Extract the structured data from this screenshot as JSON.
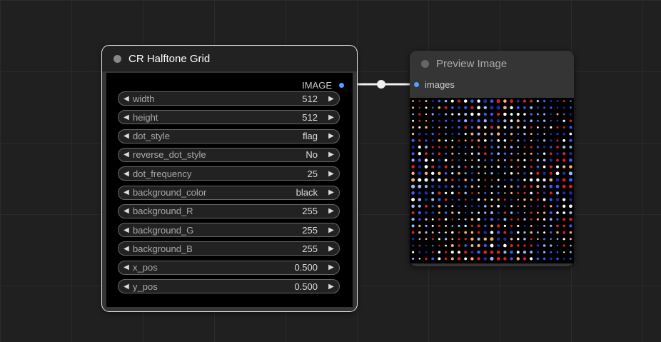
{
  "nodes": {
    "halftone": {
      "title": "CR Halftone Grid",
      "output_label": "IMAGE",
      "widgets": [
        {
          "label": "width",
          "value": "512"
        },
        {
          "label": "height",
          "value": "512"
        },
        {
          "label": "dot_style",
          "value": "flag"
        },
        {
          "label": "reverse_dot_style",
          "value": "No"
        },
        {
          "label": "dot_frequency",
          "value": "25"
        },
        {
          "label": "background_color",
          "value": "black"
        },
        {
          "label": "background_R",
          "value": "255"
        },
        {
          "label": "background_G",
          "value": "255"
        },
        {
          "label": "background_B",
          "value": "255"
        },
        {
          "label": "x_pos",
          "value": "0.500"
        },
        {
          "label": "y_pos",
          "value": "0.500"
        }
      ]
    },
    "preview": {
      "title": "Preview Image",
      "input_label": "images"
    }
  },
  "glyphs": {
    "arrow_left": "◀",
    "arrow_right": "▶"
  },
  "colors": {
    "canvas": "#202020",
    "node": "#353535",
    "slot": "#4da3ff",
    "dot_palette": [
      "#ffffff",
      "#e02020",
      "#3a5cff",
      "#ffb070",
      "#9fb8ff",
      "#1a2fb0"
    ]
  },
  "icons": {
    "slot": "circle-slot-icon",
    "title": "circle-node-icon"
  }
}
